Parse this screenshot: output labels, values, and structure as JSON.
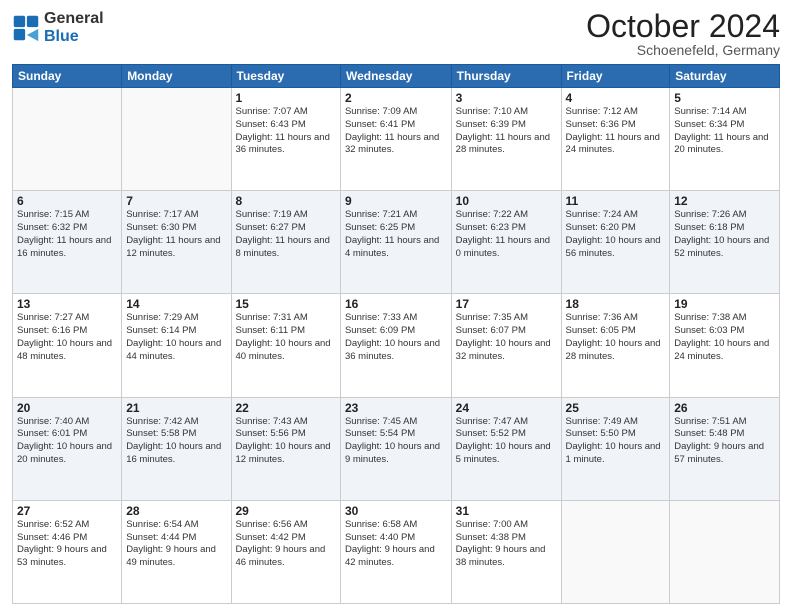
{
  "header": {
    "logo_general": "General",
    "logo_blue": "Blue",
    "month": "October 2024",
    "location": "Schoenefeld, Germany"
  },
  "weekdays": [
    "Sunday",
    "Monday",
    "Tuesday",
    "Wednesday",
    "Thursday",
    "Friday",
    "Saturday"
  ],
  "weeks": [
    [
      {
        "day": "",
        "info": ""
      },
      {
        "day": "",
        "info": ""
      },
      {
        "day": "1",
        "info": "Sunrise: 7:07 AM\nSunset: 6:43 PM\nDaylight: 11 hours and 36 minutes."
      },
      {
        "day": "2",
        "info": "Sunrise: 7:09 AM\nSunset: 6:41 PM\nDaylight: 11 hours and 32 minutes."
      },
      {
        "day": "3",
        "info": "Sunrise: 7:10 AM\nSunset: 6:39 PM\nDaylight: 11 hours and 28 minutes."
      },
      {
        "day": "4",
        "info": "Sunrise: 7:12 AM\nSunset: 6:36 PM\nDaylight: 11 hours and 24 minutes."
      },
      {
        "day": "5",
        "info": "Sunrise: 7:14 AM\nSunset: 6:34 PM\nDaylight: 11 hours and 20 minutes."
      }
    ],
    [
      {
        "day": "6",
        "info": "Sunrise: 7:15 AM\nSunset: 6:32 PM\nDaylight: 11 hours and 16 minutes."
      },
      {
        "day": "7",
        "info": "Sunrise: 7:17 AM\nSunset: 6:30 PM\nDaylight: 11 hours and 12 minutes."
      },
      {
        "day": "8",
        "info": "Sunrise: 7:19 AM\nSunset: 6:27 PM\nDaylight: 11 hours and 8 minutes."
      },
      {
        "day": "9",
        "info": "Sunrise: 7:21 AM\nSunset: 6:25 PM\nDaylight: 11 hours and 4 minutes."
      },
      {
        "day": "10",
        "info": "Sunrise: 7:22 AM\nSunset: 6:23 PM\nDaylight: 11 hours and 0 minutes."
      },
      {
        "day": "11",
        "info": "Sunrise: 7:24 AM\nSunset: 6:20 PM\nDaylight: 10 hours and 56 minutes."
      },
      {
        "day": "12",
        "info": "Sunrise: 7:26 AM\nSunset: 6:18 PM\nDaylight: 10 hours and 52 minutes."
      }
    ],
    [
      {
        "day": "13",
        "info": "Sunrise: 7:27 AM\nSunset: 6:16 PM\nDaylight: 10 hours and 48 minutes."
      },
      {
        "day": "14",
        "info": "Sunrise: 7:29 AM\nSunset: 6:14 PM\nDaylight: 10 hours and 44 minutes."
      },
      {
        "day": "15",
        "info": "Sunrise: 7:31 AM\nSunset: 6:11 PM\nDaylight: 10 hours and 40 minutes."
      },
      {
        "day": "16",
        "info": "Sunrise: 7:33 AM\nSunset: 6:09 PM\nDaylight: 10 hours and 36 minutes."
      },
      {
        "day": "17",
        "info": "Sunrise: 7:35 AM\nSunset: 6:07 PM\nDaylight: 10 hours and 32 minutes."
      },
      {
        "day": "18",
        "info": "Sunrise: 7:36 AM\nSunset: 6:05 PM\nDaylight: 10 hours and 28 minutes."
      },
      {
        "day": "19",
        "info": "Sunrise: 7:38 AM\nSunset: 6:03 PM\nDaylight: 10 hours and 24 minutes."
      }
    ],
    [
      {
        "day": "20",
        "info": "Sunrise: 7:40 AM\nSunset: 6:01 PM\nDaylight: 10 hours and 20 minutes."
      },
      {
        "day": "21",
        "info": "Sunrise: 7:42 AM\nSunset: 5:58 PM\nDaylight: 10 hours and 16 minutes."
      },
      {
        "day": "22",
        "info": "Sunrise: 7:43 AM\nSunset: 5:56 PM\nDaylight: 10 hours and 12 minutes."
      },
      {
        "day": "23",
        "info": "Sunrise: 7:45 AM\nSunset: 5:54 PM\nDaylight: 10 hours and 9 minutes."
      },
      {
        "day": "24",
        "info": "Sunrise: 7:47 AM\nSunset: 5:52 PM\nDaylight: 10 hours and 5 minutes."
      },
      {
        "day": "25",
        "info": "Sunrise: 7:49 AM\nSunset: 5:50 PM\nDaylight: 10 hours and 1 minute."
      },
      {
        "day": "26",
        "info": "Sunrise: 7:51 AM\nSunset: 5:48 PM\nDaylight: 9 hours and 57 minutes."
      }
    ],
    [
      {
        "day": "27",
        "info": "Sunrise: 6:52 AM\nSunset: 4:46 PM\nDaylight: 9 hours and 53 minutes."
      },
      {
        "day": "28",
        "info": "Sunrise: 6:54 AM\nSunset: 4:44 PM\nDaylight: 9 hours and 49 minutes."
      },
      {
        "day": "29",
        "info": "Sunrise: 6:56 AM\nSunset: 4:42 PM\nDaylight: 9 hours and 46 minutes."
      },
      {
        "day": "30",
        "info": "Sunrise: 6:58 AM\nSunset: 4:40 PM\nDaylight: 9 hours and 42 minutes."
      },
      {
        "day": "31",
        "info": "Sunrise: 7:00 AM\nSunset: 4:38 PM\nDaylight: 9 hours and 38 minutes."
      },
      {
        "day": "",
        "info": ""
      },
      {
        "day": "",
        "info": ""
      }
    ]
  ]
}
